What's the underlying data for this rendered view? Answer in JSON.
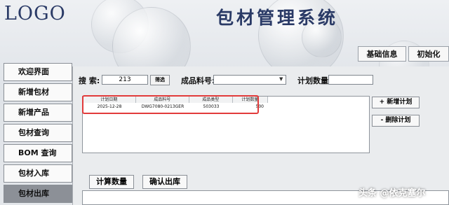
{
  "header": {
    "logo": "LOGO",
    "title": "包材管理系统"
  },
  "top_buttons": {
    "basic_info": "基础信息",
    "init": "初始化"
  },
  "sidebar": {
    "items": [
      {
        "label": "欢迎界面"
      },
      {
        "label": "新增包材"
      },
      {
        "label": "新增产品"
      },
      {
        "label": "包材查询"
      },
      {
        "label": "BOM 查询"
      },
      {
        "label": "包材入库"
      },
      {
        "label": "包材出库"
      }
    ]
  },
  "search": {
    "label": "搜 索:",
    "value": "213",
    "filter_button": "筛选",
    "product_code_label": "成品料号:",
    "product_code_value": "",
    "plan_qty_label": "计划数量:",
    "plan_qty_value": ""
  },
  "grid": {
    "columns": [
      "计划日期",
      "成品料号",
      "成品类型",
      "计划数量"
    ],
    "rows": [
      [
        "2025-12-28",
        "DWG7080-0213GER",
        "503033",
        "500"
      ]
    ]
  },
  "actions": {
    "add_plan": "+ 新增计划",
    "delete_plan": "- 删除计划"
  },
  "bottom": {
    "calc_qty": "计算数量",
    "confirm_out": "确认出库"
  },
  "watermark": "头条 @依克塞尔"
}
